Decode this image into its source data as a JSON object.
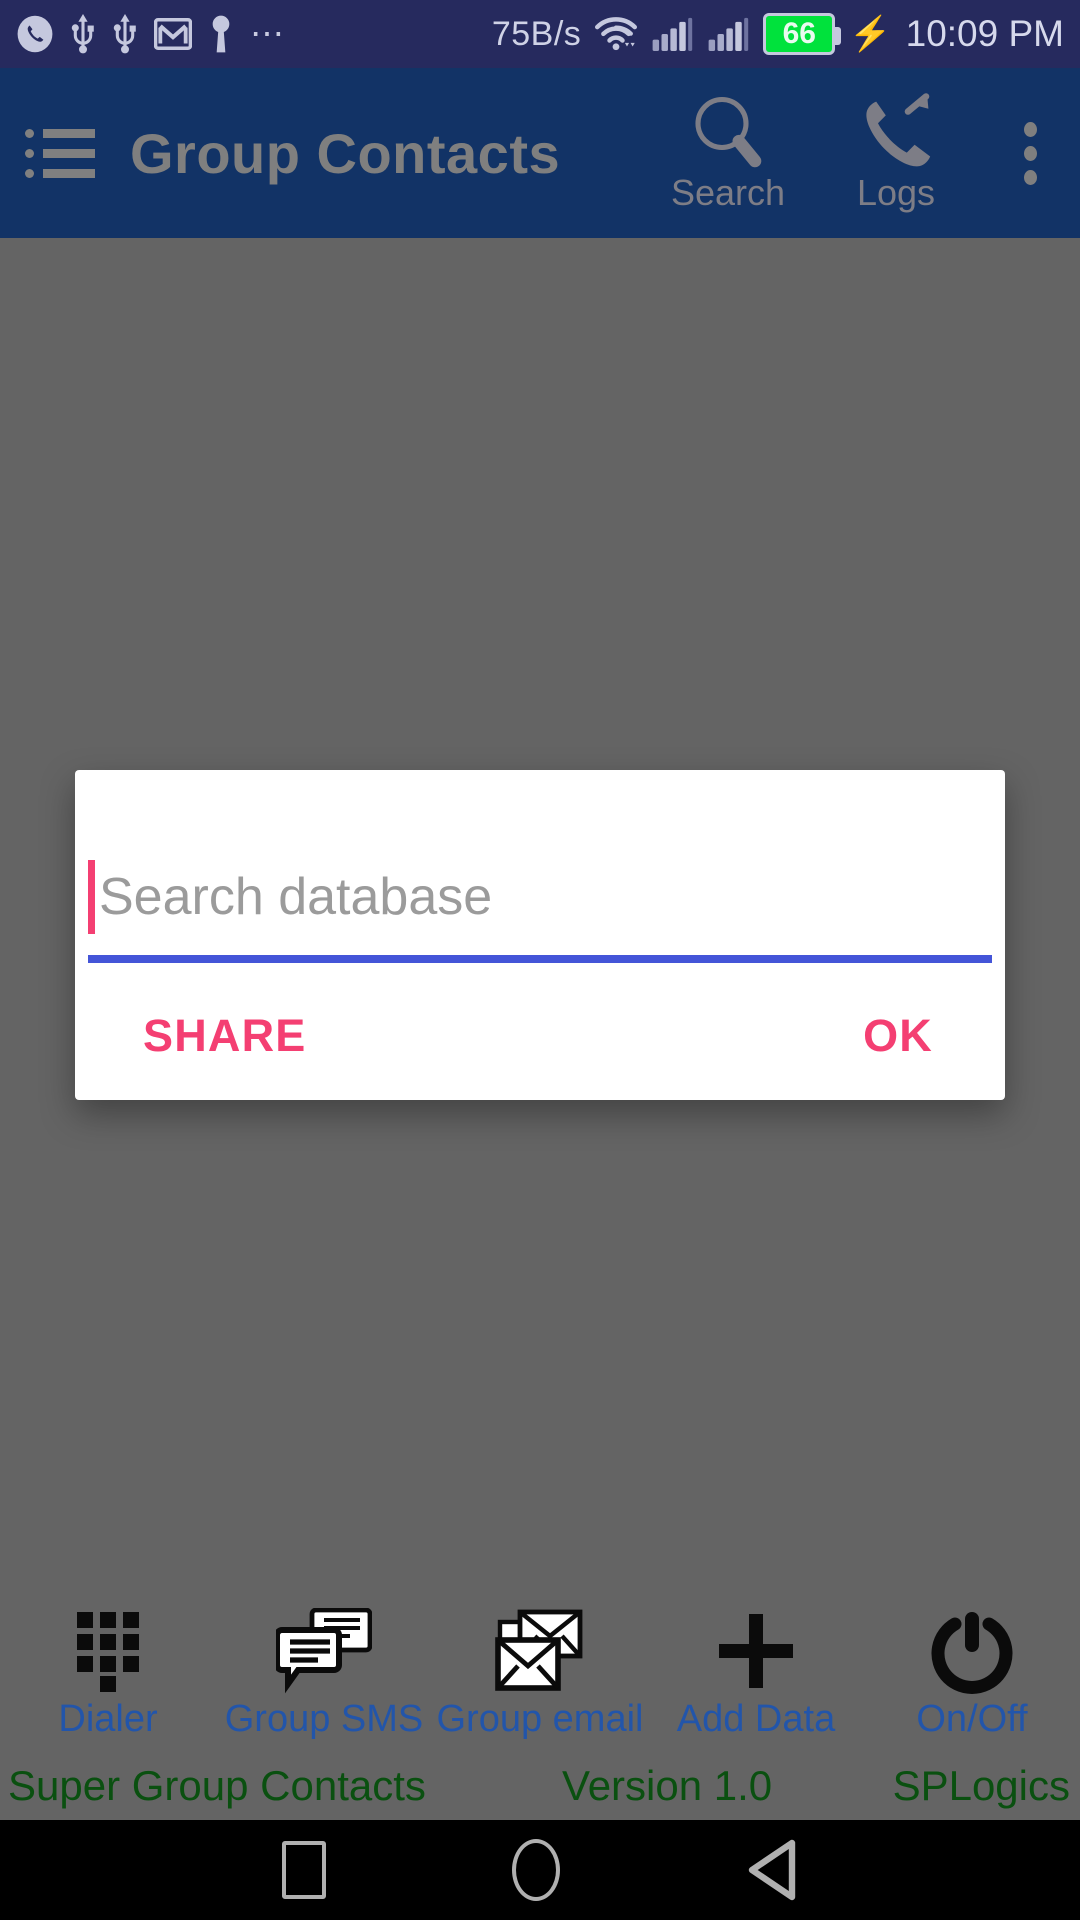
{
  "status_bar": {
    "left_icons": [
      "phone-circle-icon",
      "usb-icon",
      "usb-icon",
      "gmail-icon",
      "vpn-key-icon",
      "more-dots-icon"
    ],
    "network_speed": "75B/s",
    "wifi_icon": "wifi-icon",
    "signal_icon_1": "signal-bars-icon",
    "signal_icon_2": "signal-bars-icon",
    "battery_level": "66",
    "charging_icon": "charging-bolt-icon",
    "time": "10:09 PM",
    "background_color": "#262A5E",
    "battery_fill_color": "#00E23C"
  },
  "header": {
    "menu_icon": "hamburger-menu-icon",
    "title": "Group Contacts",
    "actions": [
      {
        "icon": "search-icon",
        "label": "Search"
      },
      {
        "icon": "call-logs-icon",
        "label": "Logs"
      }
    ],
    "overflow_icon": "overflow-menu-icon",
    "background_color": "#123366",
    "text_color": "#7F7F7F"
  },
  "dialog": {
    "input_placeholder": "Search database",
    "input_value": "",
    "cursor_color": "#F43F72",
    "underline_color": "#4455D8",
    "buttons": [
      {
        "label": "SHARE",
        "name": "share-button"
      },
      {
        "label": "OK",
        "name": "ok-button"
      }
    ],
    "button_color": "#F43F72"
  },
  "toolbar": {
    "items": [
      {
        "label": "Dialer",
        "icon": "dialpad-icon"
      },
      {
        "label": "Group SMS",
        "icon": "chat-bubbles-icon"
      },
      {
        "label": "Group email",
        "icon": "envelopes-icon"
      },
      {
        "label": "Add Data",
        "icon": "plus-icon"
      },
      {
        "label": "On/Off",
        "icon": "power-icon"
      }
    ],
    "label_color": "#2255AA"
  },
  "footer": {
    "app_name": "Super Group Contacts",
    "version": "Version 1.0",
    "company": "SPLogics",
    "text_color": "#0A5010"
  },
  "nav_bar": {
    "recents_icon": "square-recents-icon",
    "home_icon": "circle-home-icon",
    "back_icon": "triangle-back-icon"
  }
}
